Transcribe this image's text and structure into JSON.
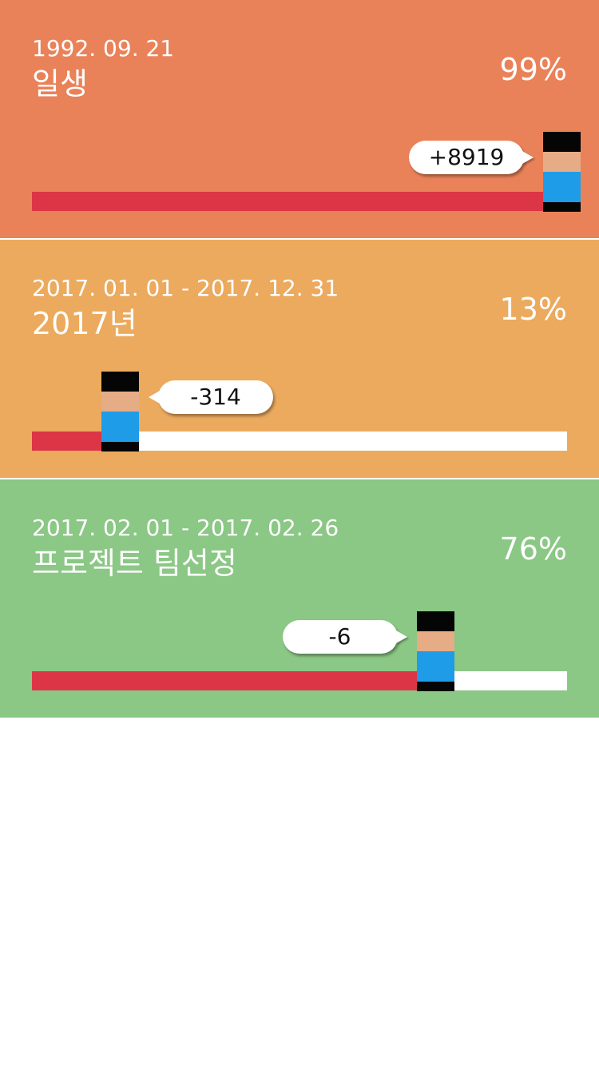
{
  "colors": {
    "fill": "#dc3545",
    "track": "#ffffff",
    "hair": "#050505",
    "face": "#e5ac85",
    "shirt": "#1e9ce8"
  },
  "cards": [
    {
      "dates": "1992. 09. 21",
      "title": "일생",
      "percent_text": "99%",
      "progress": 0.99,
      "bubble": "+8919",
      "bubble_side": "left",
      "background": "#ea8259"
    },
    {
      "dates": "2017. 01. 01 - 2017. 12. 31",
      "title": "2017년",
      "percent_text": "13%",
      "progress": 0.13,
      "bubble": "-314",
      "bubble_side": "right",
      "background": "#ebaa5e"
    },
    {
      "dates": "2017. 02. 01 - 2017. 02. 26",
      "title": "프로젝트 팀선정",
      "percent_text": "76%",
      "progress": 0.76,
      "bubble": "-6",
      "bubble_side": "left",
      "background": "#8bc785"
    }
  ]
}
